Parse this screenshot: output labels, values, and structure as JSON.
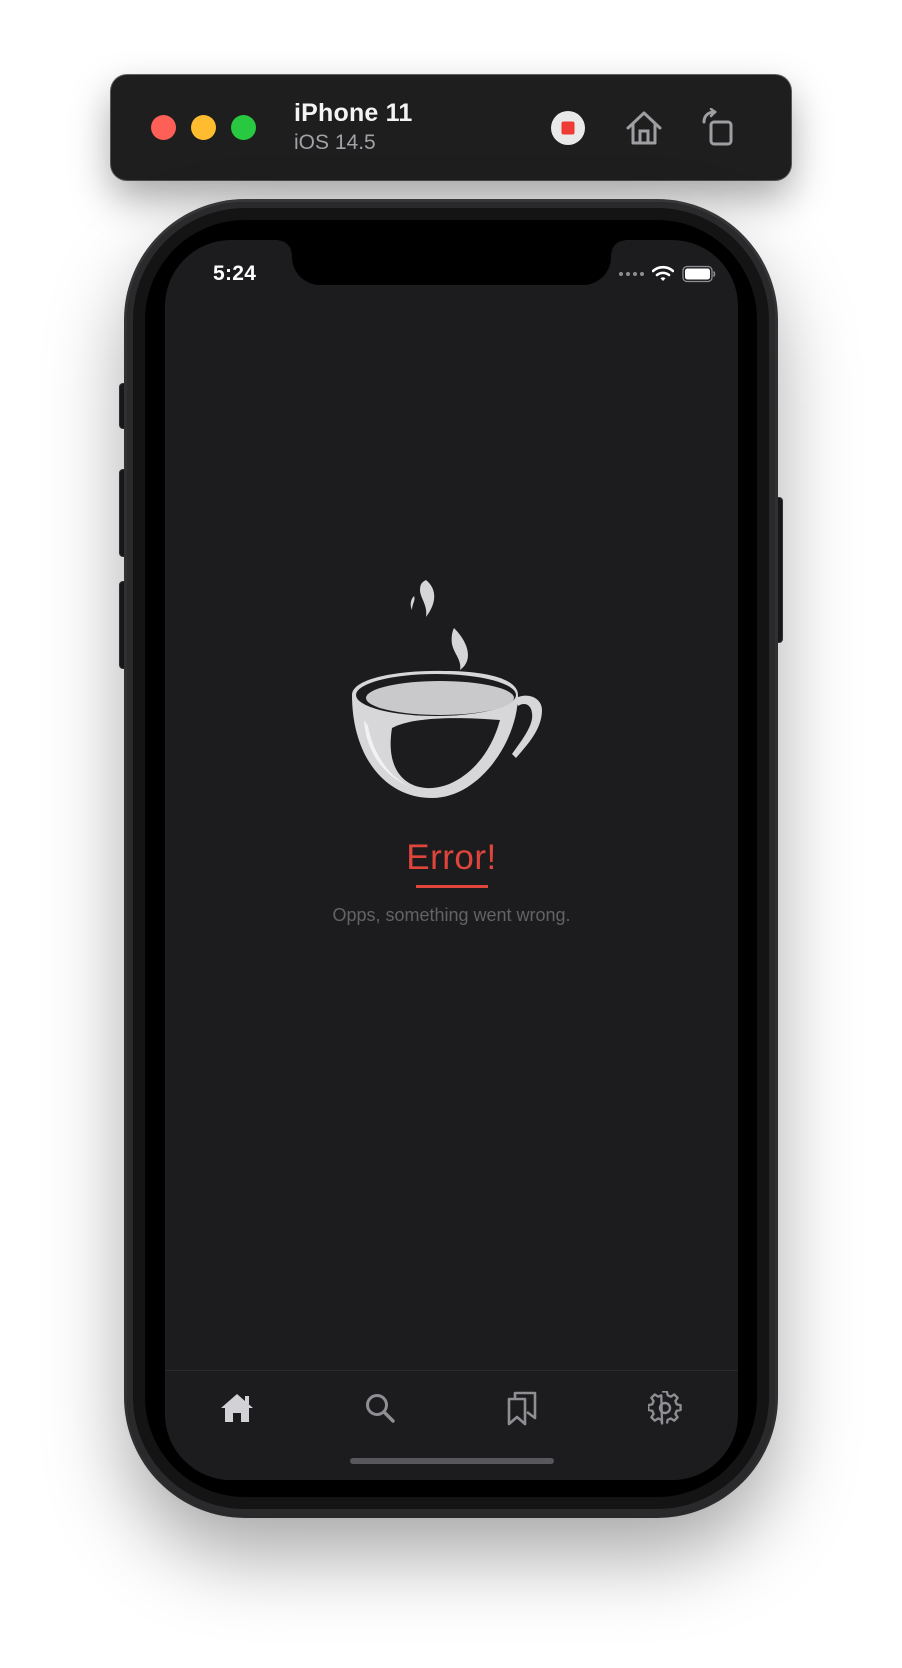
{
  "simulator": {
    "device_name": "iPhone 11",
    "os_version": "iOS 14.5",
    "buttons": {
      "record": "record-icon",
      "home": "home-icon",
      "rotate": "rotate-icon"
    },
    "colors": {
      "close": "#fe5f57",
      "minimize": "#febc2e",
      "zoom": "#28c840"
    }
  },
  "status_bar": {
    "time": "5:24",
    "icons": [
      "signal-icon",
      "wifi-icon",
      "battery-icon"
    ]
  },
  "error_view": {
    "illustration": "coffee-cup-icon",
    "title": "Error!",
    "message": "Opps, something went wrong.",
    "accent_color": "#e0453b"
  },
  "tab_bar": {
    "items": [
      {
        "icon": "home-icon",
        "active": true
      },
      {
        "icon": "search-icon",
        "active": false
      },
      {
        "icon": "bookmarks-icon",
        "active": false
      },
      {
        "icon": "settings-icon",
        "active": false
      }
    ]
  }
}
